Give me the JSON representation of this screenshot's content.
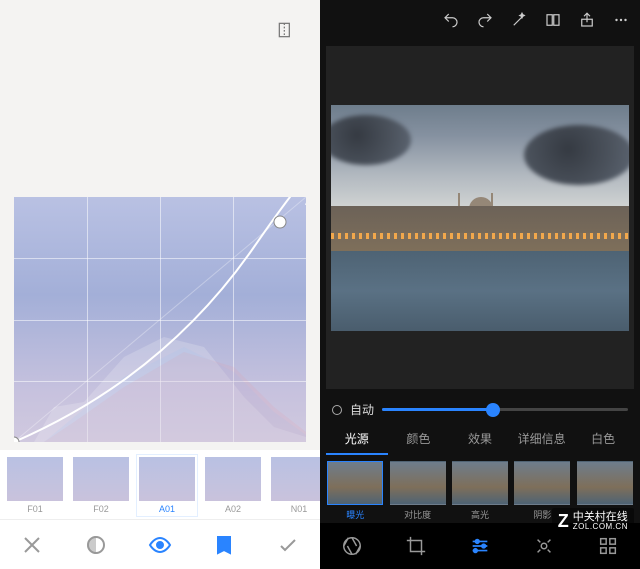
{
  "left": {
    "presets": [
      {
        "label": "F01"
      },
      {
        "label": "F02"
      },
      {
        "label": "A01",
        "active": true
      },
      {
        "label": "A02"
      },
      {
        "label": "N01"
      }
    ],
    "toolbar_icons": [
      "close",
      "vignette",
      "eye",
      "notebook",
      "check"
    ]
  },
  "right": {
    "top_icons": [
      "undo",
      "redo",
      "wand",
      "compare",
      "share",
      "more"
    ],
    "slider": {
      "label": "自动",
      "value": 45
    },
    "tabs": [
      {
        "label": "光源",
        "active": true
      },
      {
        "label": "颜色"
      },
      {
        "label": "效果"
      },
      {
        "label": "详细信息"
      },
      {
        "label": "白色"
      }
    ],
    "presets": [
      {
        "label": "曝光",
        "active": true
      },
      {
        "label": "对比度"
      },
      {
        "label": "高光"
      },
      {
        "label": "阴影"
      },
      {
        "label": ""
      }
    ],
    "toolbar_icons": [
      "aperture",
      "crop",
      "sliders",
      "heal",
      "presets"
    ]
  },
  "watermark": {
    "brand": "中关村在线",
    "url": "ZOL.COM.CN"
  }
}
